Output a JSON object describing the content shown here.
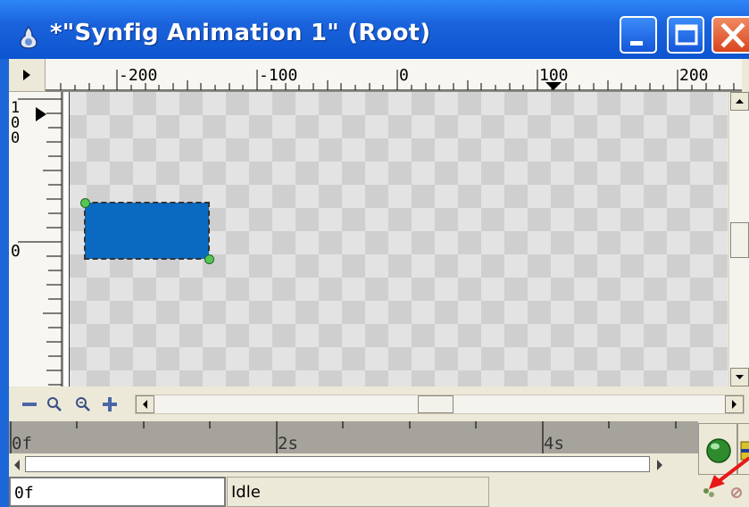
{
  "window": {
    "title": "*\"Synfig Animation 1\" (Root)"
  },
  "ruler": {
    "horizontal_labels": [
      "-200",
      "-100",
      "0",
      "100",
      "200"
    ],
    "vertical_labels": [
      "100",
      "0"
    ]
  },
  "timebar": {
    "labels": [
      "0f",
      "2s",
      "4s"
    ]
  },
  "status": {
    "current_frame": "0f",
    "state_text": "Idle"
  },
  "colors": {
    "layer_fill": "#0a6ac1",
    "title_bar": "#1a63dc",
    "close_button": "#d9451d",
    "animate_button": "#2e8b2e",
    "pointer_arrow": "#e81818"
  }
}
